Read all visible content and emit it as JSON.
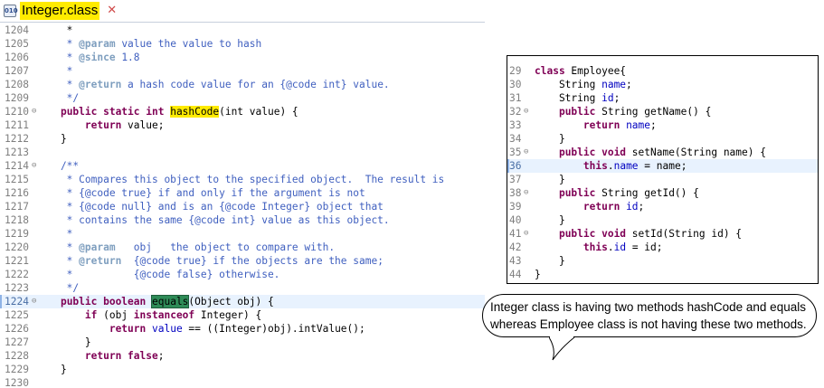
{
  "tab": {
    "title": "Integer.class",
    "icon": "010",
    "close": "✕"
  },
  "left_lines": [
    {
      "n": "1204",
      "parts": [
        [
          "",
          "     *"
        ]
      ]
    },
    {
      "n": "1205",
      "parts": [
        [
          "cm",
          "     * "
        ],
        [
          "tg",
          "@param"
        ],
        [
          "cm",
          " value the value to hash"
        ]
      ]
    },
    {
      "n": "1206",
      "parts": [
        [
          "cm",
          "     * "
        ],
        [
          "tg",
          "@since"
        ],
        [
          "cm",
          " 1.8"
        ]
      ]
    },
    {
      "n": "1207",
      "parts": [
        [
          "cm",
          "     *"
        ]
      ]
    },
    {
      "n": "1208",
      "parts": [
        [
          "cm",
          "     * "
        ],
        [
          "tg",
          "@return"
        ],
        [
          "cm",
          " a hash code value for an {@code int} value."
        ]
      ]
    },
    {
      "n": "1209",
      "parts": [
        [
          "cm",
          "     */"
        ]
      ]
    },
    {
      "n": "1210",
      "fold": "⊖",
      "parts": [
        [
          "",
          "    "
        ],
        [
          "k",
          "public static int "
        ],
        [
          "hl-y",
          "hashCode"
        ],
        [
          "",
          "(int value) {"
        ]
      ]
    },
    {
      "n": "1211",
      "parts": [
        [
          "",
          "        "
        ],
        [
          "k",
          "return"
        ],
        [
          "",
          " value;"
        ]
      ]
    },
    {
      "n": "1212",
      "parts": [
        [
          "",
          "    }"
        ]
      ]
    },
    {
      "n": "1213",
      "parts": [
        [
          "",
          ""
        ]
      ]
    },
    {
      "n": "1214",
      "fold": "⊖",
      "parts": [
        [
          "cm",
          "    /**"
        ]
      ]
    },
    {
      "n": "1215",
      "parts": [
        [
          "cm",
          "     * Compares this object to the specified object.  The result is"
        ]
      ]
    },
    {
      "n": "1216",
      "parts": [
        [
          "cm",
          "     * {@code true} if and only if the argument is not"
        ]
      ]
    },
    {
      "n": "1217",
      "parts": [
        [
          "cm",
          "     * {@code null} and is an {@code Integer} object that"
        ]
      ]
    },
    {
      "n": "1218",
      "parts": [
        [
          "cm",
          "     * contains the same {@code int} value as this object."
        ]
      ]
    },
    {
      "n": "1219",
      "parts": [
        [
          "cm",
          "     *"
        ]
      ]
    },
    {
      "n": "1220",
      "parts": [
        [
          "cm",
          "     * "
        ],
        [
          "tg",
          "@param"
        ],
        [
          "cm",
          "   obj   the object to compare with."
        ]
      ]
    },
    {
      "n": "1221",
      "parts": [
        [
          "cm",
          "     * "
        ],
        [
          "tg",
          "@return"
        ],
        [
          "cm",
          "  {@code true} if the objects are the same;"
        ]
      ]
    },
    {
      "n": "1222",
      "parts": [
        [
          "cm",
          "     *          {@code false} otherwise."
        ]
      ]
    },
    {
      "n": "1223",
      "parts": [
        [
          "cm",
          "     */"
        ]
      ]
    },
    {
      "n": "1224",
      "fold": "⊖",
      "active": true,
      "parts": [
        [
          "",
          "    "
        ],
        [
          "k",
          "public boolean "
        ],
        [
          "hl-g",
          "equals"
        ],
        [
          "",
          "(Object obj) {"
        ]
      ]
    },
    {
      "n": "1225",
      "parts": [
        [
          "",
          "        "
        ],
        [
          "k",
          "if"
        ],
        [
          "",
          " (obj "
        ],
        [
          "k",
          "instanceof"
        ],
        [
          "",
          " Integer) {"
        ]
      ]
    },
    {
      "n": "1226",
      "parts": [
        [
          "",
          "            "
        ],
        [
          "k",
          "return"
        ],
        [
          "",
          " "
        ],
        [
          "fld",
          "value"
        ],
        [
          "",
          " == ((Integer)obj).intValue();"
        ]
      ]
    },
    {
      "n": "1227",
      "parts": [
        [
          "",
          "        }"
        ]
      ]
    },
    {
      "n": "1228",
      "parts": [
        [
          "",
          "        "
        ],
        [
          "k",
          "return false"
        ],
        [
          "",
          ";"
        ]
      ]
    },
    {
      "n": "1229",
      "parts": [
        [
          "",
          "    }"
        ]
      ]
    },
    {
      "n": "1230",
      "parts": [
        [
          "",
          ""
        ]
      ]
    }
  ],
  "right_lines": [
    {
      "n": "29",
      "parts": [
        [
          "k",
          "class"
        ],
        [
          "",
          " Employee{"
        ]
      ]
    },
    {
      "n": "30",
      "parts": [
        [
          "",
          "    String "
        ],
        [
          "fld",
          "name"
        ],
        [
          "",
          ";"
        ]
      ]
    },
    {
      "n": "31",
      "parts": [
        [
          "",
          "    String "
        ],
        [
          "fld",
          "id"
        ],
        [
          "",
          ";"
        ]
      ]
    },
    {
      "n": "32",
      "fold": "⊖",
      "parts": [
        [
          "",
          "    "
        ],
        [
          "k",
          "public"
        ],
        [
          "",
          " String getName() {"
        ]
      ]
    },
    {
      "n": "33",
      "parts": [
        [
          "",
          "        "
        ],
        [
          "k",
          "return"
        ],
        [
          "",
          " "
        ],
        [
          "fld",
          "name"
        ],
        [
          "",
          ";"
        ]
      ]
    },
    {
      "n": "34",
      "parts": [
        [
          "",
          "    }"
        ]
      ]
    },
    {
      "n": "35",
      "fold": "⊖",
      "parts": [
        [
          "",
          "    "
        ],
        [
          "k",
          "public void"
        ],
        [
          "",
          " setName(String name) {"
        ]
      ]
    },
    {
      "n": "36",
      "active": true,
      "parts": [
        [
          "",
          "        "
        ],
        [
          "k",
          "this"
        ],
        [
          "",
          "."
        ],
        [
          "fld",
          "name"
        ],
        [
          "",
          " = name;"
        ]
      ]
    },
    {
      "n": "37",
      "parts": [
        [
          "",
          "    }"
        ]
      ]
    },
    {
      "n": "38",
      "fold": "⊖",
      "parts": [
        [
          "",
          "    "
        ],
        [
          "k",
          "public"
        ],
        [
          "",
          " String getId() {"
        ]
      ]
    },
    {
      "n": "39",
      "parts": [
        [
          "",
          "        "
        ],
        [
          "k",
          "return"
        ],
        [
          "",
          " "
        ],
        [
          "fld",
          "id"
        ],
        [
          "",
          ";"
        ]
      ]
    },
    {
      "n": "40",
      "parts": [
        [
          "",
          "    }"
        ]
      ]
    },
    {
      "n": "41",
      "fold": "⊖",
      "parts": [
        [
          "",
          "    "
        ],
        [
          "k",
          "public void"
        ],
        [
          "",
          " setId(String id) {"
        ]
      ]
    },
    {
      "n": "42",
      "parts": [
        [
          "",
          "        "
        ],
        [
          "k",
          "this"
        ],
        [
          "",
          "."
        ],
        [
          "fld",
          "id"
        ],
        [
          "",
          " = id;"
        ]
      ]
    },
    {
      "n": "43",
      "parts": [
        [
          "",
          "    }"
        ]
      ]
    },
    {
      "n": "44",
      "parts": [
        [
          "",
          "}"
        ]
      ]
    }
  ],
  "callout": {
    "line1": "Integer class is having two methods hashCode and equals",
    "line2": "whereas Employee class is not having these two methods."
  }
}
